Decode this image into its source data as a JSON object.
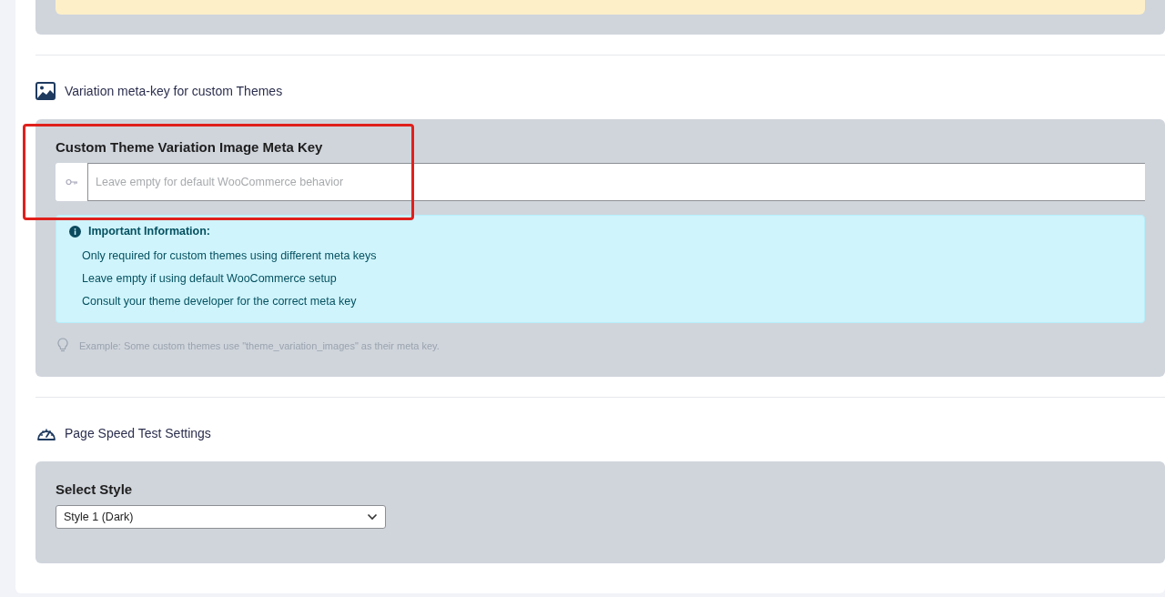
{
  "sections": [
    {
      "heading": "Variation meta-key for custom Themes",
      "field": {
        "kind": "text",
        "label": "Custom Theme Variation Image Meta Key",
        "placeholder": "Leave empty for default WooCommerce behavior",
        "highlighted": true,
        "info": {
          "title": "Important Information:",
          "items": [
            "Only required for custom themes using different meta keys",
            "Leave empty if using default WooCommerce setup",
            "Consult your theme developer for the correct meta key"
          ]
        },
        "hint": "Example: Some custom themes use \"theme_variation_images\" as their meta key."
      }
    },
    {
      "heading": "Page Speed Test Settings",
      "field": {
        "kind": "select",
        "label": "Select Style",
        "value": "Style 1 (Dark)"
      }
    }
  ]
}
